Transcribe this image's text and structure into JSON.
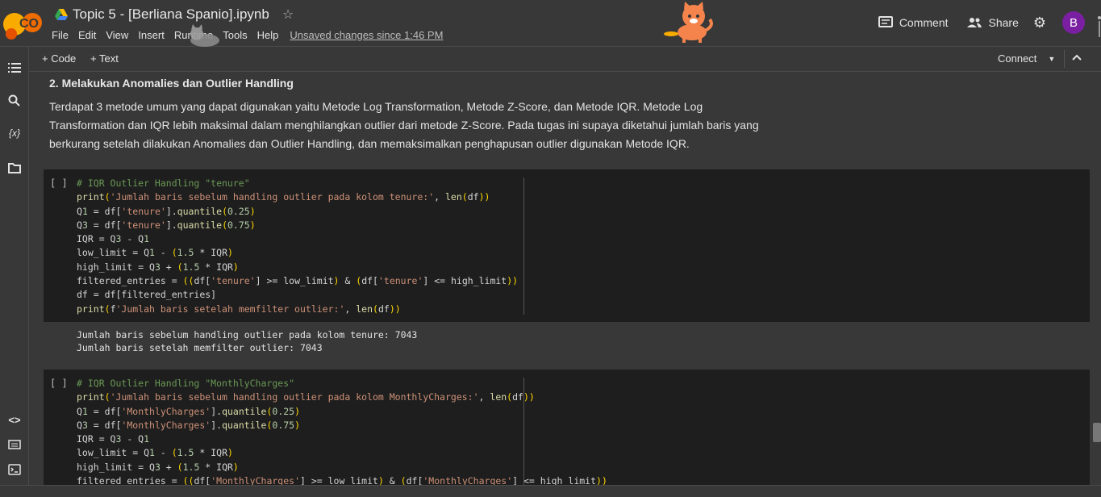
{
  "header": {
    "title": "Topic 5 - [Berliana Spanio].ipynb",
    "menu": [
      "File",
      "Edit",
      "View",
      "Insert",
      "Runtime",
      "Tools",
      "Help"
    ],
    "unsaved": "Unsaved changes since 1:46 PM",
    "comment_label": "Comment",
    "share_label": "Share",
    "avatar_letter": "B",
    "logo_text": "CO"
  },
  "toolbar": {
    "code_label": "+ Code",
    "text_label": "+ Text",
    "connect_label": "Connect"
  },
  "markdown": {
    "heading": "2. Melakukan Anomalies dan Outlier Handling",
    "lines": [
      "Terdapat 3 metode umum yang dapat digunakan yaitu Metode Log Transformation, Metode Z-Score, dan Metode IQR. Metode Log",
      "Transformation dan IQR lebih maksimal dalam menghilangkan outlier dari metode Z-Score. Pada tugas ini supaya diketahui jumlah baris yang",
      "berkurang setelah dilakukan Anomalies dan Outlier Handling, dan memaksimalkan penghapusan outlier digunakan Metode IQR."
    ]
  },
  "cells": [
    {
      "run_label": "[ ]",
      "code": [
        "# IQR Outlier Handling \"tenure\"",
        "print('Jumlah baris sebelum handling outlier pada kolom tenure:', len(df))",
        "Q1 = df['tenure'].quantile(0.25)",
        "Q3 = df['tenure'].quantile(0.75)",
        "IQR = Q3 - Q1",
        "low_limit = Q1 - (1.5 * IQR)",
        "high_limit = Q3 + (1.5 * IQR)",
        "filtered_entries = ((df['tenure'] >= low_limit) & (df['tenure'] <= high_limit))",
        "df = df[filtered_entries]",
        "print(f'Jumlah baris setelah memfilter outlier:', len(df))"
      ],
      "output": [
        "Jumlah baris sebelum handling outlier pada kolom tenure: 7043",
        "Jumlah baris setelah memfilter outlier: 7043"
      ]
    },
    {
      "run_label": "[ ]",
      "code": [
        "# IQR Outlier Handling \"MonthlyCharges\"",
        "print('Jumlah baris sebelum handling outlier pada kolom MonthlyCharges:', len(df))",
        "Q1 = df['MonthlyCharges'].quantile(0.25)",
        "Q3 = df['MonthlyCharges'].quantile(0.75)",
        "IQR = Q3 - Q1",
        "low_limit = Q1 - (1.5 * IQR)",
        "high_limit = Q3 + (1.5 * IQR)",
        "filtered_entries = ((df['MonthlyCharges'] >= low_limit) & (df['MonthlyCharges'] <= high_limit))"
      ]
    }
  ],
  "icons": {
    "rail": [
      "toc-icon",
      "search-icon",
      "variables-icon",
      "folder-icon",
      "code-snippets-icon",
      "command-palette-icon",
      "terminal-icon"
    ]
  }
}
